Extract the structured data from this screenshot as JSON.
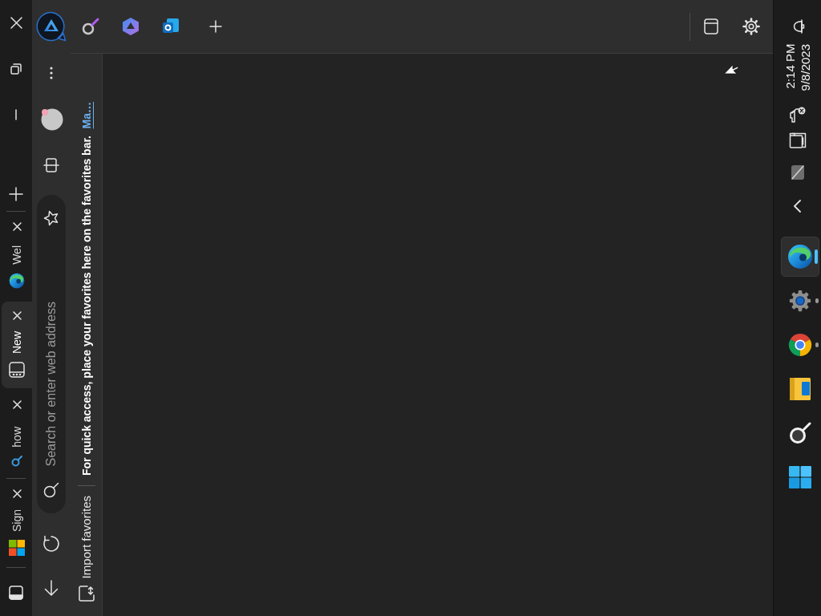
{
  "tab_strip": {
    "tabs": [
      {
        "title": "Wel",
        "kind": "edge",
        "selected": false
      },
      {
        "title": "New",
        "kind": "newtab",
        "selected": true
      },
      {
        "title": "how",
        "kind": "search",
        "selected": false
      },
      {
        "title": "Sign",
        "kind": "microsoft",
        "selected": false
      }
    ]
  },
  "address_bar": {
    "placeholder": "Search or enter web address"
  },
  "favorites_bar": {
    "import_button": "Import favorites",
    "message": "For quick access, place your favorites here on the favorites bar.",
    "link": "Ma…"
  },
  "sidebar": {
    "apps": [
      {
        "kind": "search"
      },
      {
        "kind": "copilot"
      },
      {
        "kind": "outlook"
      }
    ]
  },
  "taskbar": {
    "time": "2:14 PM",
    "date": "9/8/2023",
    "apps": [
      {
        "kind": "edge",
        "open": true,
        "selected": true
      },
      {
        "kind": "settings",
        "open": true,
        "selected": false
      },
      {
        "kind": "chrome",
        "open": true,
        "selected": false
      },
      {
        "kind": "explorer",
        "open": false,
        "selected": false
      },
      {
        "kind": "search",
        "open": false,
        "selected": false
      },
      {
        "kind": "start",
        "open": false,
        "selected": false
      }
    ]
  }
}
